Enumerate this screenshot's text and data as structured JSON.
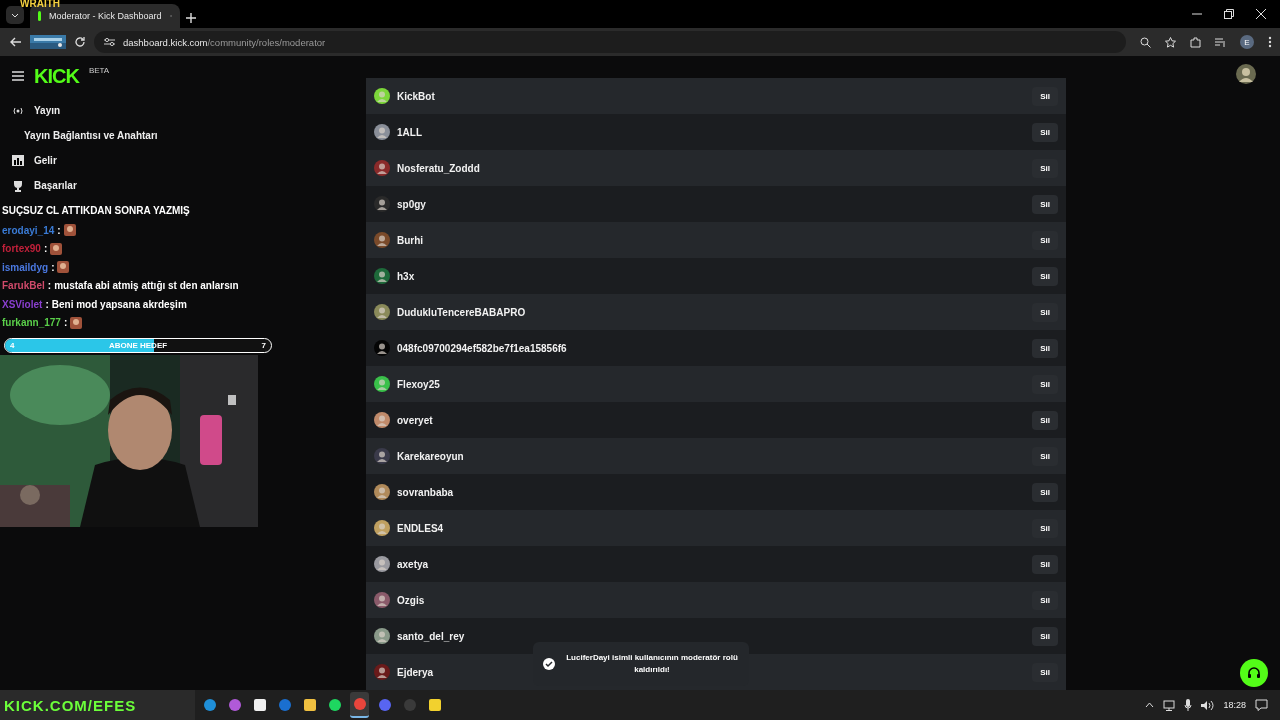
{
  "overlay_label": "WRAITH",
  "browser": {
    "tab_title": "Moderator - Kick Dashboard",
    "url_domain": "dashboard.kick.com",
    "url_path": "/community/roles/moderator",
    "profile_initial": "E"
  },
  "header": {
    "logo": "KICK",
    "logo_badge": "BETA"
  },
  "sidebar": {
    "items": [
      {
        "label": "Yayın",
        "kind": "broadcast"
      },
      {
        "label": "Yayın Bağlantısı ve Anahtarı",
        "kind": "sub"
      },
      {
        "label": "Gelir",
        "kind": "chart"
      },
      {
        "label": "Başarılar",
        "kind": "trophy"
      }
    ]
  },
  "moderators": [
    {
      "name": "KickBot",
      "action": "Sil"
    },
    {
      "name": "1ALL",
      "action": "Sil"
    },
    {
      "name": "Nosferatu_Zoddd",
      "action": "Sil"
    },
    {
      "name": "sp0gy",
      "action": "Sil"
    },
    {
      "name": "Burhi",
      "action": "Sil"
    },
    {
      "name": "h3x",
      "action": "Sil"
    },
    {
      "name": "DudukluTencereBABAPRO",
      "action": "Sil"
    },
    {
      "name": "048fc09700294ef582be7f1ea15856f6",
      "action": "Sil"
    },
    {
      "name": "Flexoy25",
      "action": "Sil"
    },
    {
      "name": "overyet",
      "action": "Sil"
    },
    {
      "name": "Karekareoyun",
      "action": "Sil"
    },
    {
      "name": "sovranbaba",
      "action": "Sil"
    },
    {
      "name": "ENDLES4",
      "action": "Sil"
    },
    {
      "name": "axetya",
      "action": "Sil"
    },
    {
      "name": "Ozgis",
      "action": "Sil"
    },
    {
      "name": "santo_del_rey",
      "action": "Sil"
    },
    {
      "name": "Ejderya",
      "action": "Sil"
    }
  ],
  "toast": {
    "message": "LuciferDayi isimli kullanıcının moderatör rolü kaldırıldı!"
  },
  "stream_chat": {
    "title": "SUÇSUZ CL ATTIKDAN SONRA YAZMIŞ",
    "separator": ":",
    "messages": [
      {
        "user": "erodayi_14",
        "color": "#3a7bd5",
        "kind": "emote"
      },
      {
        "user": "fortex90",
        "color": "#c0203a",
        "kind": "emote"
      },
      {
        "user": "ismaildyg",
        "color": "#4a78e0",
        "kind": "emote"
      },
      {
        "user": "FarukBel",
        "color": "#d04a6a",
        "kind": "text",
        "text": "mustafa abi atmiş attığı st den anlarsın"
      },
      {
        "user": "XSViolet",
        "color": "#8a3fd0",
        "kind": "text",
        "text": "Beni mod yapsana akrdeşim"
      },
      {
        "user": "furkann_177",
        "color": "#5ad04a",
        "kind": "emote"
      }
    ]
  },
  "goal": {
    "label": "ABONE HEDEF",
    "current": "4",
    "target": "7",
    "level": 0.56
  },
  "stream_banner": "KICK.COM/EFES",
  "taskbar": {
    "apps": [
      {
        "kind": "edge",
        "selected": false
      },
      {
        "kind": "copilot",
        "selected": false
      },
      {
        "kind": "store",
        "selected": false
      },
      {
        "kind": "outlook",
        "selected": false
      },
      {
        "kind": "explorer",
        "selected": false
      },
      {
        "kind": "spotify",
        "selected": false
      },
      {
        "kind": "chrome",
        "selected": true
      },
      {
        "kind": "discord",
        "selected": false
      },
      {
        "kind": "obs",
        "selected": false
      },
      {
        "kind": "notes",
        "selected": false
      }
    ],
    "time": "18:28"
  }
}
